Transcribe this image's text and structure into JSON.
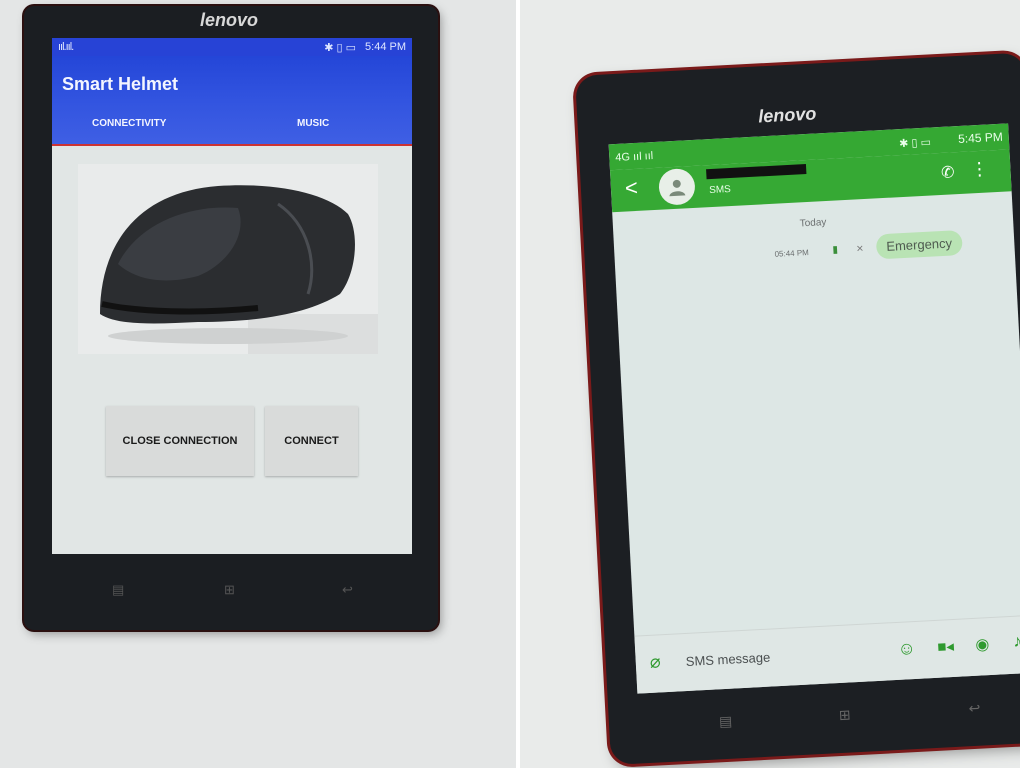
{
  "left_phone": {
    "brand": "lenovo",
    "status": {
      "signal": "ııl.ııl.",
      "icons": "✱ ▯ ▭",
      "time": "5:44 PM"
    },
    "app_title": "Smart Helmet",
    "tabs": [
      {
        "label": "CONNECTIVITY"
      },
      {
        "label": "MUSIC"
      }
    ],
    "buttons": {
      "close_connection": "CLOSE CONNECTION",
      "connect": "CONNECT"
    },
    "nav": {
      "menu_icon": "▤",
      "home_icon": "⊞",
      "back_icon": "↩"
    }
  },
  "right_phone": {
    "brand": "lenovo",
    "status": {
      "signal": "4G ııl ııl",
      "icons": "✱ ▯ ▭",
      "time": "5:45 PM"
    },
    "header": {
      "back_icon": "<",
      "subtitle": "SMS",
      "call_icon": "✆",
      "more_icon": "⋮"
    },
    "conversation": {
      "date_label": "Today",
      "message_time": "05:44 PM",
      "message_text": "Emergency"
    },
    "composer": {
      "placeholder": "SMS message"
    },
    "nav": {
      "menu_icon": "▤",
      "home_icon": "⊞",
      "back_icon": "↩"
    }
  },
  "colors": {
    "left_appbar": "#2446d8",
    "right_appbar": "#36a934",
    "bubble": "#b9e3b4"
  }
}
